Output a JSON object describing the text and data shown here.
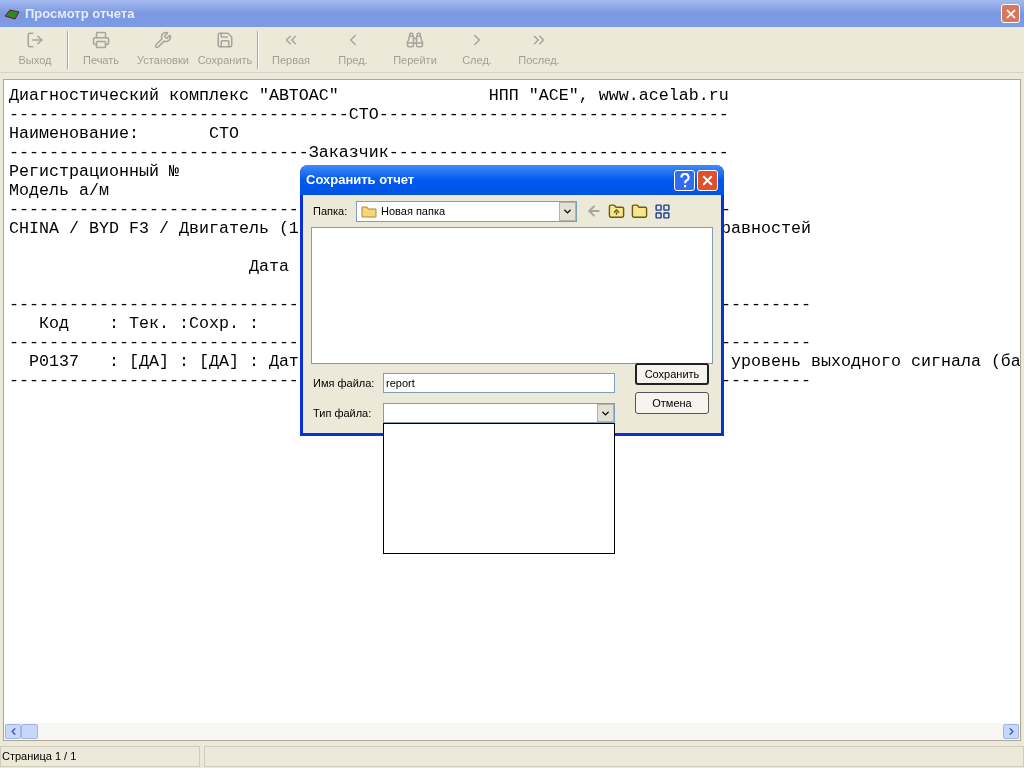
{
  "window": {
    "title": "Просмотр отчета"
  },
  "toolbar": [
    [
      {
        "label": "Выход",
        "disabled": true
      }
    ],
    [
      {
        "label": "Печать",
        "disabled": true
      },
      {
        "label": "Установки",
        "disabled": true
      },
      {
        "label": "Сохранить",
        "disabled": true
      }
    ],
    [
      {
        "label": "Первая",
        "disabled": true
      },
      {
        "label": "Пред.",
        "disabled": true
      },
      {
        "label": "Перейти",
        "disabled": true
      },
      {
        "label": "След.",
        "disabled": true
      },
      {
        "label": "Послед.",
        "disabled": true
      }
    ]
  ],
  "report": {
    "lines": [
      {
        "text": "Диагностический комплекс \"АВТОАС\"               НПП \"ACE\", www.acelab.ru"
      },
      {
        "text": "----------------------------------СТО-----------------------------------"
      },
      {
        "text": "Наименование:       СТО"
      },
      {
        "text": "------------------------------Заказчик----------------------------------"
      },
      {
        "left": "Регистрационный №"
      },
      {
        "left": "Модель а/м"
      },
      {
        "left": "-----------------------------",
        "right": "-"
      },
      {
        "left": "CHINA / BYD F3 / Двигатель (1",
        "right": "равностей"
      },
      {
        "left": "                        Дата",
        "blank_before": true
      },
      {
        "left": "-----------------------------",
        "right": "---------",
        "blank_before": true
      },
      {
        "left": "   Код    : Тек. :Сохр. :"
      },
      {
        "left": "-----------------------------",
        "right": "---------"
      },
      {
        "left": "  P0137   : [ДА] : [ДА] : Дат",
        "right": " уровень выходного сигнала (ба"
      },
      {
        "left": "-----------------------------",
        "right": "---------"
      }
    ]
  },
  "dialog": {
    "title": "Сохранить отчет",
    "folder_label": "Папка:",
    "folder": "Новая папка",
    "filename_label": "Имя файла:",
    "filename": "report",
    "filetype_label": "Тип файла:",
    "filetype_list_open": true,
    "buttons": [
      "Сохранить",
      "Отмена"
    ]
  },
  "status_bar": {
    "page": "Страница 1 / 1"
  }
}
